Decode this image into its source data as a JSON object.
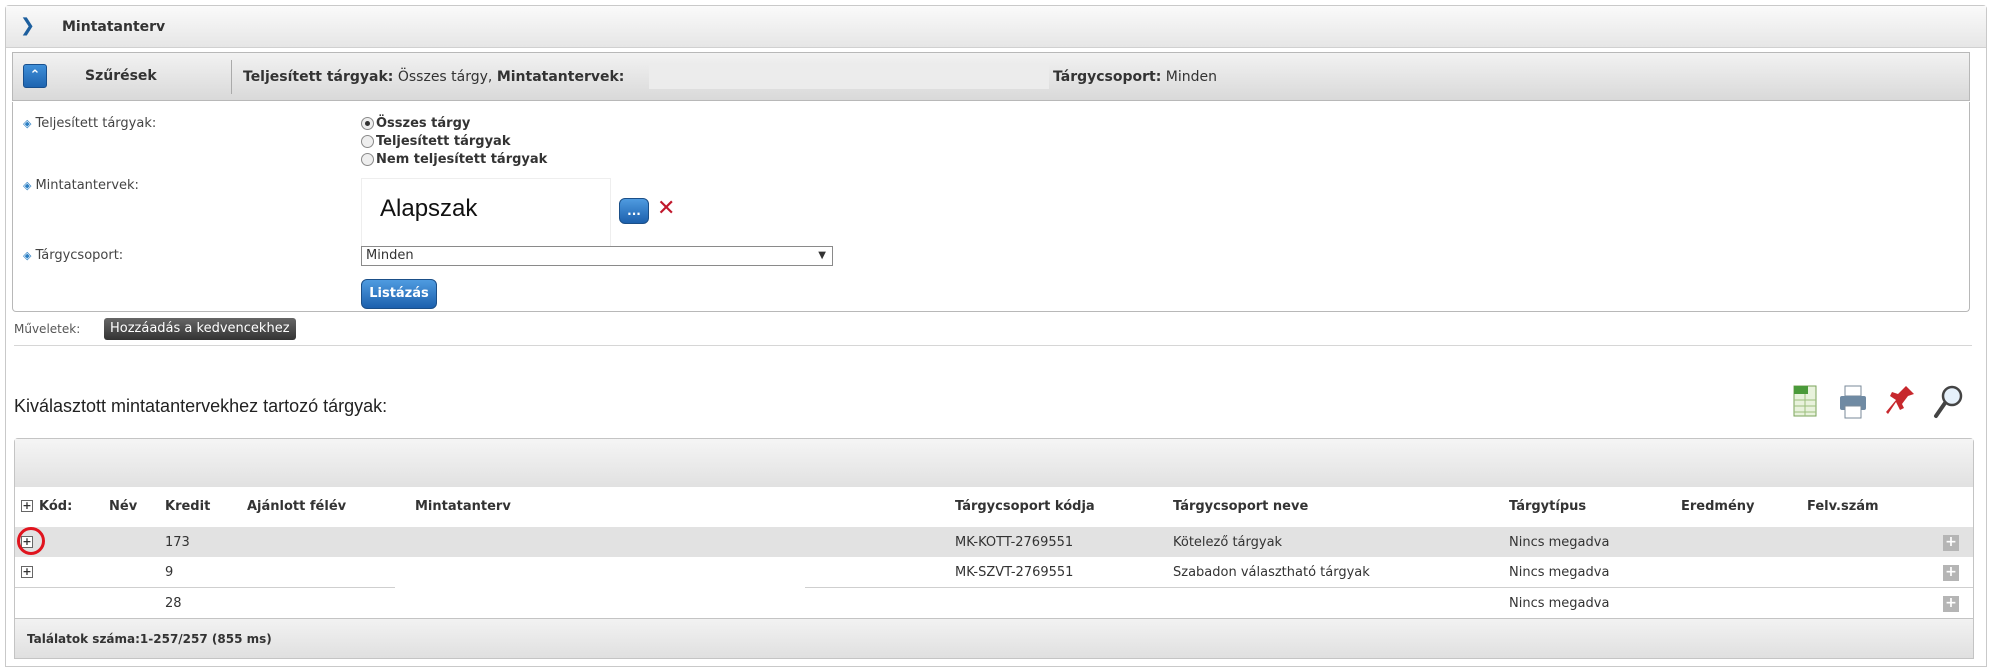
{
  "panel": {
    "title": "Mintatanterv"
  },
  "filters": {
    "header_label": "Szűrések",
    "summary_completed_key": "Teljesített tárgyak:",
    "summary_completed_val": "Összes tárgy,",
    "summary_curriculum_key": "Mintatantervek:",
    "summary_group_key": "Tárgycsoport:",
    "summary_group_val": "Minden",
    "completed_label": "Teljesített tárgyak:",
    "radio_options": [
      "Összes tárgy",
      "Teljesített tárgyak",
      "Nem teljesített tárgyak"
    ],
    "radio_selected": 0,
    "curriculum_label": "Mintatantervek:",
    "curriculum_value": "Alapszak",
    "curriculum_browse": "...",
    "curriculum_clear": "✕",
    "group_label": "Tárgycsoport:",
    "group_value": "Minden",
    "list_button": "Listázás"
  },
  "operations": {
    "label": "Műveletek:",
    "favorite_button": "Hozzáadás a kedvencekhez"
  },
  "results": {
    "title": "Kiválasztott mintatantervekhez tartozó tárgyak:",
    "tools": [
      "xls-export-icon",
      "print-icon",
      "pin-icon",
      "search-icon"
    ],
    "columns": [
      "Kód:",
      "Név",
      "Kredit",
      "Ajánlott félév",
      "Mintatanterv",
      "Tárgycsoport kódja",
      "Tárgycsoport neve",
      "Tárgytípus",
      "Eredmény",
      "Felv.szám"
    ],
    "rows": [
      {
        "credit": "173",
        "group_code": "MK-KOTT-2769551",
        "group_name": "Kötelező tárgyak",
        "type": "Nincs megadva"
      },
      {
        "credit": "9",
        "group_code": "MK-SZVT-2769551",
        "group_name": "Szabadon választható tárgyak",
        "type": "Nincs megadva"
      },
      {
        "credit": "28",
        "group_code": "",
        "group_name": "",
        "type": "Nincs megadva"
      }
    ],
    "footer": "Találatok száma:1-257/257 (855 ms)"
  }
}
